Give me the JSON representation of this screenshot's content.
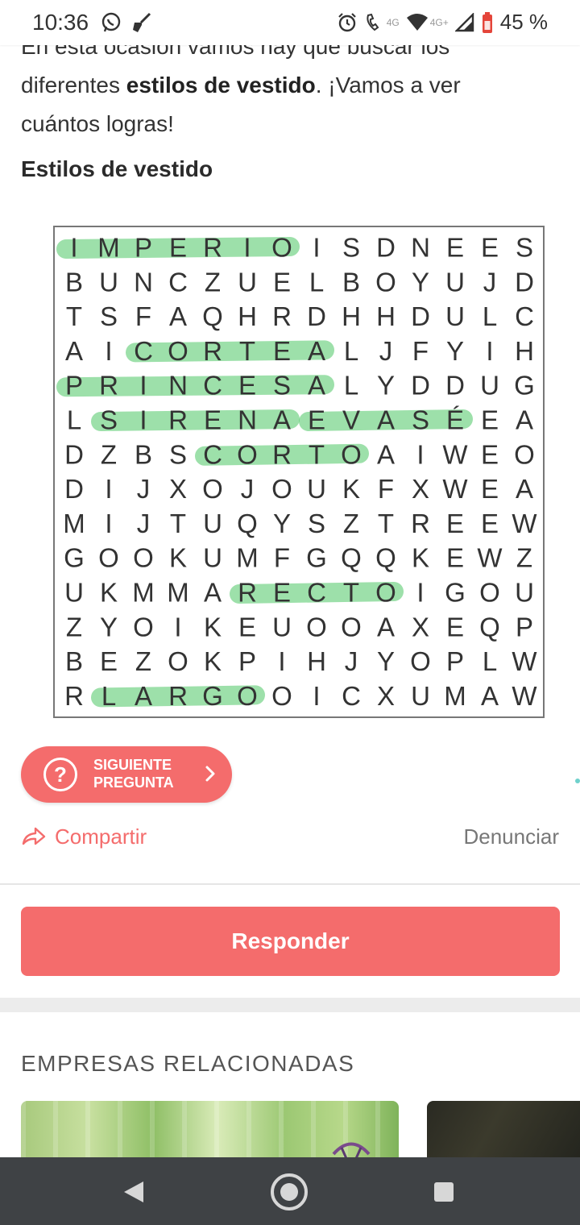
{
  "status_bar": {
    "time": "10:36",
    "left_icons": [
      "whatsapp-icon",
      "broom-icon"
    ],
    "right_icons": [
      "alarm-icon",
      "volte-call-icon",
      "wifi-icon",
      "signal-icon",
      "battery-icon"
    ],
    "call_tag": "4G",
    "network_tag": "4G+",
    "battery_percent": "45 %"
  },
  "article": {
    "intro_cutoff": "En esta ocasión vamos hay que buscar los",
    "intro_line2_start": "diferentes ",
    "intro_bold": "estilos de vestido",
    "intro_line2_end": ". ¡Vamos a ver",
    "intro_line3": "cuántos logras!",
    "section_title": "Estilos de vestido"
  },
  "puzzle": {
    "grid": [
      [
        "I",
        "M",
        "P",
        "E",
        "R",
        "I",
        "O",
        "I",
        "S",
        "D",
        "N",
        "E",
        "E",
        "S"
      ],
      [
        "B",
        "U",
        "N",
        "C",
        "Z",
        "U",
        "E",
        "L",
        "B",
        "O",
        "Y",
        "U",
        "J",
        "D"
      ],
      [
        "T",
        "S",
        "F",
        "A",
        "Q",
        "H",
        "R",
        "D",
        "H",
        "H",
        "D",
        "U",
        "L",
        "C"
      ],
      [
        "A",
        "I",
        "C",
        "O",
        "R",
        "T",
        "E",
        "A",
        "L",
        "J",
        "F",
        "Y",
        "I",
        "H"
      ],
      [
        "P",
        "R",
        "I",
        "N",
        "C",
        "E",
        "S",
        "A",
        "L",
        "Y",
        "D",
        "D",
        "U",
        "G"
      ],
      [
        "L",
        "S",
        "I",
        "R",
        "E",
        "N",
        "A",
        "E",
        "V",
        "A",
        "S",
        "É",
        "E",
        "A"
      ],
      [
        "D",
        "Z",
        "B",
        "S",
        "C",
        "O",
        "R",
        "T",
        "O",
        "A",
        "I",
        "W",
        "E",
        "O"
      ],
      [
        "D",
        "I",
        "J",
        "X",
        "O",
        "J",
        "O",
        "U",
        "K",
        "F",
        "X",
        "W",
        "E",
        "A"
      ],
      [
        "M",
        "I",
        "J",
        "T",
        "U",
        "Q",
        "Y",
        "S",
        "Z",
        "T",
        "R",
        "E",
        "E",
        "W"
      ],
      [
        "G",
        "O",
        "O",
        "K",
        "U",
        "M",
        "F",
        "G",
        "Q",
        "Q",
        "K",
        "E",
        "W",
        "Z"
      ],
      [
        "U",
        "K",
        "M",
        "M",
        "A",
        "R",
        "E",
        "C",
        "T",
        "O",
        "I",
        "G",
        "O",
        "U"
      ],
      [
        "Z",
        "Y",
        "O",
        "I",
        "K",
        "E",
        "U",
        "O",
        "O",
        "A",
        "X",
        "E",
        "Q",
        "P"
      ],
      [
        "B",
        "E",
        "Z",
        "O",
        "K",
        "P",
        "I",
        "H",
        "J",
        "Y",
        "O",
        "P",
        "L",
        "W"
      ],
      [
        "R",
        "L",
        "A",
        "R",
        "G",
        "O",
        "O",
        "I",
        "C",
        "X",
        "U",
        "M",
        "A",
        "W"
      ]
    ],
    "found_words": [
      {
        "word": "IMPERIO",
        "row": 0,
        "col_start": 0,
        "col_end": 6
      },
      {
        "word": "CORTE A",
        "row": 3,
        "col_start": 2,
        "col_end": 7
      },
      {
        "word": "PRINCESA",
        "row": 4,
        "col_start": 0,
        "col_end": 7
      },
      {
        "word": "SIRENA",
        "row": 5,
        "col_start": 1,
        "col_end": 6
      },
      {
        "word": "EVASÉ",
        "row": 5,
        "col_start": 7,
        "col_end": 11
      },
      {
        "word": "CORTO",
        "row": 6,
        "col_start": 4,
        "col_end": 8
      },
      {
        "word": "RECTO",
        "row": 10,
        "col_start": 5,
        "col_end": 9
      },
      {
        "word": "LARGO",
        "row": 13,
        "col_start": 1,
        "col_end": 5
      }
    ],
    "highlight_color": "#4cc765"
  },
  "actions": {
    "next_question_line1": "SIGUIENTE",
    "next_question_line2": "PREGUNTA",
    "question_icon_glyph": "?",
    "share_label": "Compartir",
    "report_label": "Denunciar",
    "reply_label": "Responder"
  },
  "related": {
    "title": "EMPRESAS RELACIONADAS"
  },
  "colors": {
    "accent": "#f46c6c",
    "nav_bar": "#3f4245",
    "text": "#333333"
  },
  "nav": {
    "icons": [
      "back-icon",
      "home-icon",
      "recent-apps-icon"
    ]
  }
}
